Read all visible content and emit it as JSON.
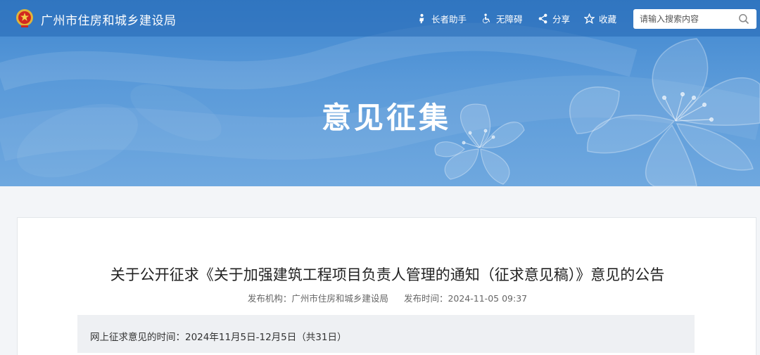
{
  "header": {
    "site_name": "广州市住房和城乡建设局",
    "tools": [
      {
        "label": "长者助手",
        "icon": "elder-assistant-icon"
      },
      {
        "label": "无障碍",
        "icon": "accessibility-icon"
      },
      {
        "label": "分享",
        "icon": "share-icon"
      },
      {
        "label": "收藏",
        "icon": "star-icon"
      }
    ],
    "search": {
      "placeholder": "请输入搜索内容",
      "value": ""
    }
  },
  "banner": {
    "title": "意见征集"
  },
  "article": {
    "title": "关于公开征求《关于加强建筑工程项目负责人管理的通知（征求意见稿）》意见的公告",
    "publisher_label": "发布机构：",
    "publisher": "广州市住房和城乡建设局",
    "time_label": "发布时间：",
    "time": "2024-11-05 09:37",
    "period_text": "网上征求意见的时间：2024年11月5日-12月5日（共31日）"
  },
  "colors": {
    "banner_top": "#3f86cf",
    "banner_bottom": "#6fa8df",
    "topbar": "#2468b4",
    "info_box": "#eef0f3"
  }
}
